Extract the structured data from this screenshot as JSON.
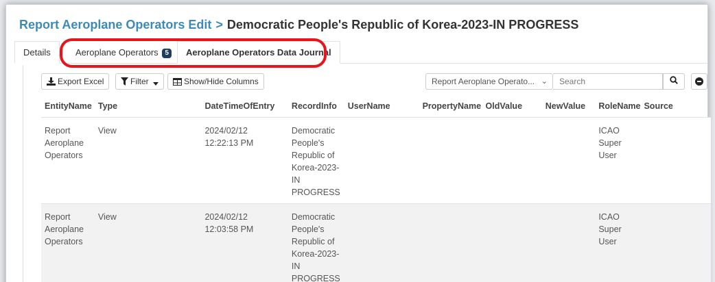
{
  "breadcrumb": {
    "parent": "Report Aeroplane Operators Edit",
    "separator": ">",
    "current": "Democratic People's Republic of Korea-2023-IN PROGRESS"
  },
  "tabs": [
    {
      "label": "Details",
      "badge": null
    },
    {
      "label": "Aeroplane Operators",
      "badge": "5"
    },
    {
      "label": "Aeroplane Operators Data Journal",
      "badge": null,
      "active": true
    }
  ],
  "toolbar": {
    "export_label": "Export Excel",
    "filter_label": "Filter",
    "showhide_label": "Show/Hide Columns",
    "report_select_value": "Report Aeroplane Operato...",
    "search_placeholder": "Search"
  },
  "table": {
    "columns": [
      "EntityName",
      "Type",
      "DateTimeOfEntry",
      "RecordInfo",
      "UserName",
      "PropertyName",
      "OldValue",
      "NewValue",
      "RoleName",
      "Source"
    ],
    "rows": [
      {
        "entity_name": "Report Aeroplane Operators",
        "type": "View",
        "date_time": "2024/02/12 12:22:13 PM",
        "record_info": "Democratic People's Republic of Korea-2023-IN PROGRESS",
        "user_name": "",
        "property_name": "",
        "old_value": "",
        "new_value": "",
        "role_name": "ICAO Super User",
        "source": ""
      },
      {
        "entity_name": "Report Aeroplane Operators",
        "type": "View",
        "date_time": "2024/02/12 12:03:58 PM",
        "record_info": "Democratic People's Republic of Korea-2023-IN PROGRESS",
        "user_name": "",
        "property_name": "",
        "old_value": "",
        "new_value": "",
        "role_name": "ICAO Super User",
        "source": ""
      }
    ]
  },
  "colors": {
    "link": "#3e8ab5",
    "badge": "#1f3d5c",
    "highlight": "#e8141b"
  }
}
